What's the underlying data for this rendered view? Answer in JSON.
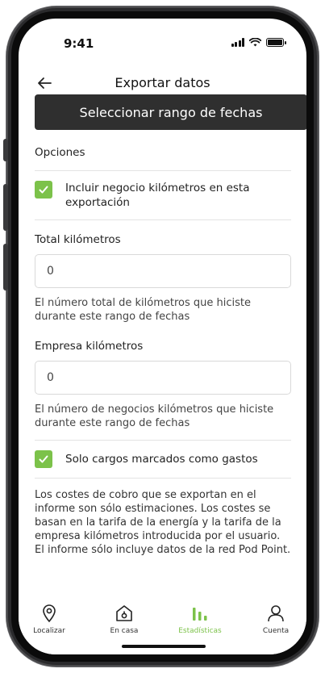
{
  "status": {
    "time": "9:41"
  },
  "header": {
    "title": "Exportar datos"
  },
  "range_button": {
    "label": "Seleccionar rango de fechas"
  },
  "options": {
    "heading": "Opciones",
    "include_business": {
      "label": "Incluir negocio kilómetros en esta exportación",
      "checked": true
    }
  },
  "total_km": {
    "label": "Total kilómetros",
    "value": "0",
    "helper": "El número total de kilómetros que hiciste durante este rango de fechas"
  },
  "business_km": {
    "label": "Empresa kilómetros",
    "value": "0",
    "helper": "El número de negocios kilómetros que hiciste durante este rango de fechas"
  },
  "expenses_only": {
    "label": "Solo cargos marcados como gastos",
    "checked": true
  },
  "disclaimer": "Los costes de cobro que se exportan en el informe son sólo estimaciones. Los costes se basan en la tarifa de la energía y la tarifa de la empresa kilómetros introducida por el usuario. El informe sólo incluye datos de la red Pod Point.",
  "tabs": [
    {
      "label": "Localizar",
      "icon": "location-pin-icon",
      "active": false
    },
    {
      "label": "En casa",
      "icon": "home-charger-icon",
      "active": false
    },
    {
      "label": "Estadísticas",
      "icon": "bar-chart-icon",
      "active": true
    },
    {
      "label": "Cuenta",
      "icon": "user-icon",
      "active": false
    }
  ],
  "colors": {
    "accent": "#7cc24a",
    "button": "#2f2f2f"
  }
}
